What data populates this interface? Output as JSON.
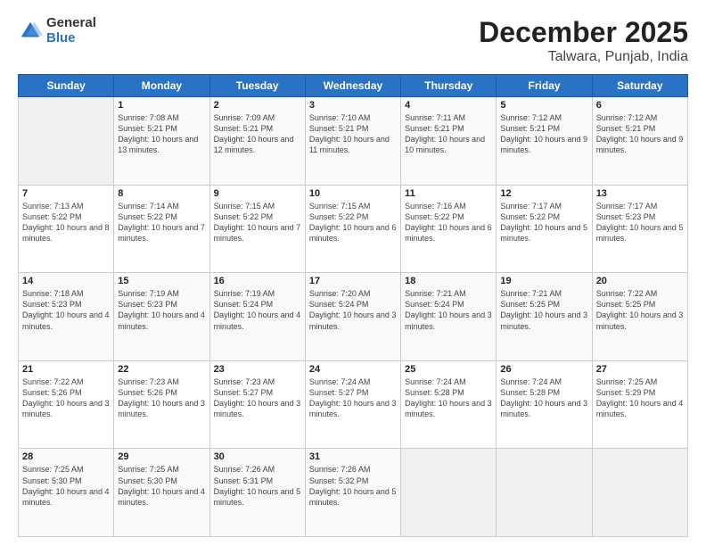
{
  "logo": {
    "general": "General",
    "blue": "Blue"
  },
  "header": {
    "month_year": "December 2025",
    "location": "Talwara, Punjab, India"
  },
  "days_of_week": [
    "Sunday",
    "Monday",
    "Tuesday",
    "Wednesday",
    "Thursday",
    "Friday",
    "Saturday"
  ],
  "weeks": [
    [
      {
        "day": "",
        "content": ""
      },
      {
        "day": "1",
        "sunrise": "7:08 AM",
        "sunset": "5:21 PM",
        "daylight": "10 hours and 13 minutes."
      },
      {
        "day": "2",
        "sunrise": "7:09 AM",
        "sunset": "5:21 PM",
        "daylight": "10 hours and 12 minutes."
      },
      {
        "day": "3",
        "sunrise": "7:10 AM",
        "sunset": "5:21 PM",
        "daylight": "10 hours and 11 minutes."
      },
      {
        "day": "4",
        "sunrise": "7:11 AM",
        "sunset": "5:21 PM",
        "daylight": "10 hours and 10 minutes."
      },
      {
        "day": "5",
        "sunrise": "7:12 AM",
        "sunset": "5:21 PM",
        "daylight": "10 hours and 9 minutes."
      },
      {
        "day": "6",
        "sunrise": "7:12 AM",
        "sunset": "5:21 PM",
        "daylight": "10 hours and 9 minutes."
      }
    ],
    [
      {
        "day": "7",
        "sunrise": "7:13 AM",
        "sunset": "5:22 PM",
        "daylight": "10 hours and 8 minutes."
      },
      {
        "day": "8",
        "sunrise": "7:14 AM",
        "sunset": "5:22 PM",
        "daylight": "10 hours and 7 minutes."
      },
      {
        "day": "9",
        "sunrise": "7:15 AM",
        "sunset": "5:22 PM",
        "daylight": "10 hours and 7 minutes."
      },
      {
        "day": "10",
        "sunrise": "7:15 AM",
        "sunset": "5:22 PM",
        "daylight": "10 hours and 6 minutes."
      },
      {
        "day": "11",
        "sunrise": "7:16 AM",
        "sunset": "5:22 PM",
        "daylight": "10 hours and 6 minutes."
      },
      {
        "day": "12",
        "sunrise": "7:17 AM",
        "sunset": "5:22 PM",
        "daylight": "10 hours and 5 minutes."
      },
      {
        "day": "13",
        "sunrise": "7:17 AM",
        "sunset": "5:23 PM",
        "daylight": "10 hours and 5 minutes."
      }
    ],
    [
      {
        "day": "14",
        "sunrise": "7:18 AM",
        "sunset": "5:23 PM",
        "daylight": "10 hours and 4 minutes."
      },
      {
        "day": "15",
        "sunrise": "7:19 AM",
        "sunset": "5:23 PM",
        "daylight": "10 hours and 4 minutes."
      },
      {
        "day": "16",
        "sunrise": "7:19 AM",
        "sunset": "5:24 PM",
        "daylight": "10 hours and 4 minutes."
      },
      {
        "day": "17",
        "sunrise": "7:20 AM",
        "sunset": "5:24 PM",
        "daylight": "10 hours and 3 minutes."
      },
      {
        "day": "18",
        "sunrise": "7:21 AM",
        "sunset": "5:24 PM",
        "daylight": "10 hours and 3 minutes."
      },
      {
        "day": "19",
        "sunrise": "7:21 AM",
        "sunset": "5:25 PM",
        "daylight": "10 hours and 3 minutes."
      },
      {
        "day": "20",
        "sunrise": "7:22 AM",
        "sunset": "5:25 PM",
        "daylight": "10 hours and 3 minutes."
      }
    ],
    [
      {
        "day": "21",
        "sunrise": "7:22 AM",
        "sunset": "5:26 PM",
        "daylight": "10 hours and 3 minutes."
      },
      {
        "day": "22",
        "sunrise": "7:23 AM",
        "sunset": "5:26 PM",
        "daylight": "10 hours and 3 minutes."
      },
      {
        "day": "23",
        "sunrise": "7:23 AM",
        "sunset": "5:27 PM",
        "daylight": "10 hours and 3 minutes."
      },
      {
        "day": "24",
        "sunrise": "7:24 AM",
        "sunset": "5:27 PM",
        "daylight": "10 hours and 3 minutes."
      },
      {
        "day": "25",
        "sunrise": "7:24 AM",
        "sunset": "5:28 PM",
        "daylight": "10 hours and 3 minutes."
      },
      {
        "day": "26",
        "sunrise": "7:24 AM",
        "sunset": "5:28 PM",
        "daylight": "10 hours and 3 minutes."
      },
      {
        "day": "27",
        "sunrise": "7:25 AM",
        "sunset": "5:29 PM",
        "daylight": "10 hours and 4 minutes."
      }
    ],
    [
      {
        "day": "28",
        "sunrise": "7:25 AM",
        "sunset": "5:30 PM",
        "daylight": "10 hours and 4 minutes."
      },
      {
        "day": "29",
        "sunrise": "7:25 AM",
        "sunset": "5:30 PM",
        "daylight": "10 hours and 4 minutes."
      },
      {
        "day": "30",
        "sunrise": "7:26 AM",
        "sunset": "5:31 PM",
        "daylight": "10 hours and 5 minutes."
      },
      {
        "day": "31",
        "sunrise": "7:26 AM",
        "sunset": "5:32 PM",
        "daylight": "10 hours and 5 minutes."
      },
      {
        "day": "",
        "content": ""
      },
      {
        "day": "",
        "content": ""
      },
      {
        "day": "",
        "content": ""
      }
    ]
  ]
}
